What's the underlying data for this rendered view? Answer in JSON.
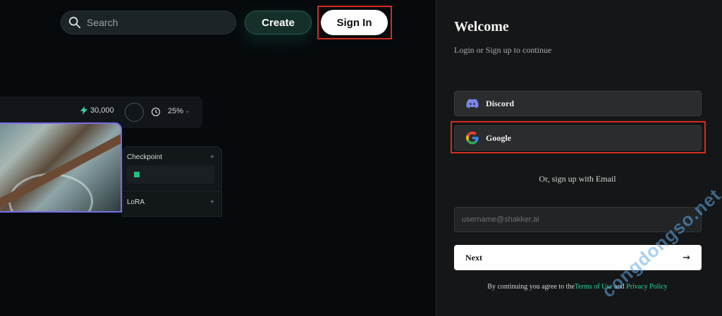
{
  "header": {
    "search_placeholder": "Search",
    "create_label": "Create",
    "signin_label": "Sign In"
  },
  "stats": {
    "credits": "30,000",
    "percent": "25%"
  },
  "panel": {
    "checkpoint_label": "Checkpoint",
    "lora_label": "LoRA",
    "plus": "+"
  },
  "auth": {
    "title": "Welcome",
    "subtitle": "Login or Sign up to continue",
    "discord_label": "Discord",
    "google_label": "Google",
    "or_text": "Or, sign up with Email",
    "email_placeholder": "username@shakker.ai",
    "next_label": "Next",
    "next_arrow": "→",
    "terms_prefix": "By continuing you agree to the",
    "terms_link": "Terms of Use",
    "terms_and": " and ",
    "privacy_link": "Privacy Policy"
  },
  "watermark": "congdongso.net",
  "colors": {
    "accent_green": "#2fd7a4",
    "highlight_red": "#d22d1f",
    "selection_purple": "#7a6ee8"
  }
}
